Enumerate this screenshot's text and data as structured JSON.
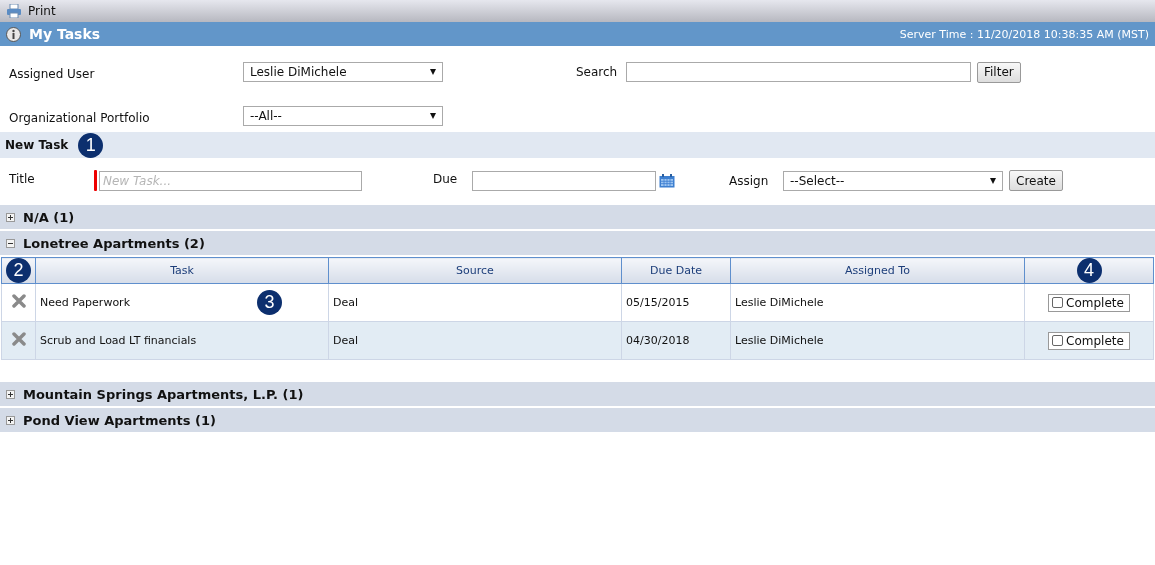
{
  "toolbar": {
    "print_label": "Print"
  },
  "header": {
    "title": "My Tasks",
    "server_time": "Server Time : 11/20/2018 10:38:35 AM (MST)"
  },
  "filters": {
    "assigned_user": {
      "label": "Assigned User",
      "value": "Leslie DiMichele"
    },
    "search": {
      "label": "Search"
    },
    "filter_button": "Filter",
    "portfolio": {
      "label": "Organizational Portfolio",
      "value": "--All--"
    }
  },
  "new_task": {
    "heading": "New Task",
    "callout": "1",
    "title_label": "Title",
    "title_placeholder": "New Task...",
    "due_label": "Due",
    "assign_label": "Assign",
    "assign_value": "--Select--",
    "create_button": "Create"
  },
  "groups": [
    {
      "name": "N/A (1)",
      "expanded": false
    },
    {
      "name": "Lonetree Apartments (2)",
      "expanded": true,
      "table": {
        "columns": [
          {
            "callout": "2"
          },
          {
            "label": "Task"
          },
          {
            "label": "Source"
          },
          {
            "label": "Due Date"
          },
          {
            "label": "Assigned To"
          },
          {
            "callout": "4"
          }
        ],
        "rows": [
          {
            "task": "Need Paperwork",
            "callout": "3",
            "source": "Deal",
            "due_date": "05/15/2015",
            "assigned_to": "Leslie DiMichele",
            "complete_label": "Complete",
            "checked": false
          },
          {
            "task": "Scrub and Load LT financials",
            "source": "Deal",
            "due_date": "04/30/2018",
            "assigned_to": "Leslie DiMichele",
            "complete_label": "Complete",
            "checked": false
          }
        ]
      }
    },
    {
      "name": "Mountain Springs Apartments, L.P. (1)",
      "expanded": false
    },
    {
      "name": "Pond View Apartments (1)",
      "expanded": false
    }
  ]
}
